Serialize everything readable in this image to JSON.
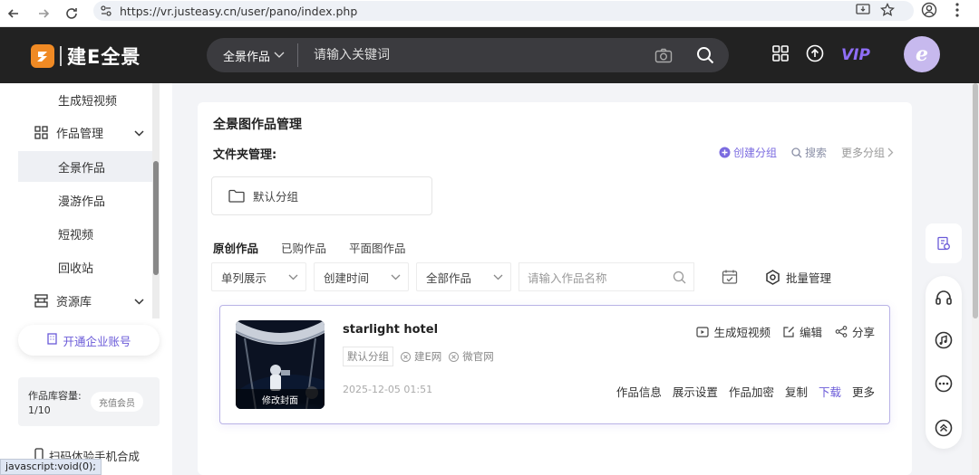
{
  "browser": {
    "url": "https://vr.justeasy.cn/user/pano/index.php"
  },
  "header": {
    "logo_badge": "ꆈ",
    "logo_text": "建E全景",
    "search_category": "全景作品",
    "search_placeholder": "请输入关键词",
    "vip_label": "VIP",
    "avatar_letter": "e"
  },
  "sidebar": {
    "generate_video": "生成短视频",
    "works_group": "作品管理",
    "items": [
      {
        "label": "全景作品",
        "active": true
      },
      {
        "label": "漫游作品",
        "active": false
      },
      {
        "label": "短视频",
        "active": false
      },
      {
        "label": "回收站",
        "active": false
      }
    ],
    "resources_group": "资源库",
    "enterprise_btn": "开通企业账号",
    "capacity_label": "作品库容量:",
    "capacity_value": "1/10",
    "recharge_btn": "充值会员",
    "scan_item": "扫码体验手机合成",
    "status_tip": "javascript:void(0);"
  },
  "main": {
    "title": "全景图作品管理",
    "folder_label": "文件夹管理:",
    "create_group": "创建分组",
    "search": "搜索",
    "more_groups": "更多分组",
    "default_folder": "默认分组",
    "tabs": [
      "原创作品",
      "已购作品",
      "平面图作品"
    ],
    "filters": {
      "layout": "单列展示",
      "sort": "创建时间",
      "scope": "全部作品",
      "name_placeholder": "请输入作品名称"
    },
    "batch_manage": "批量管理",
    "work": {
      "cover_label": "修改封面",
      "title": "starlight hotel",
      "group_tag": "默认分组",
      "tag1": "建E网",
      "tag2": "微官网",
      "date": "2025-12-05 01:51",
      "actions": [
        "生成短视频",
        "编辑",
        "分享"
      ],
      "links": [
        "作品信息",
        "展示设置",
        "作品加密",
        "复制",
        "下载",
        "更多"
      ]
    }
  },
  "colors": {
    "header_bg": "#222222",
    "accent": "#6a5ad8",
    "logo_orange": "#f08a24",
    "vip": "#8f6ef7"
  }
}
